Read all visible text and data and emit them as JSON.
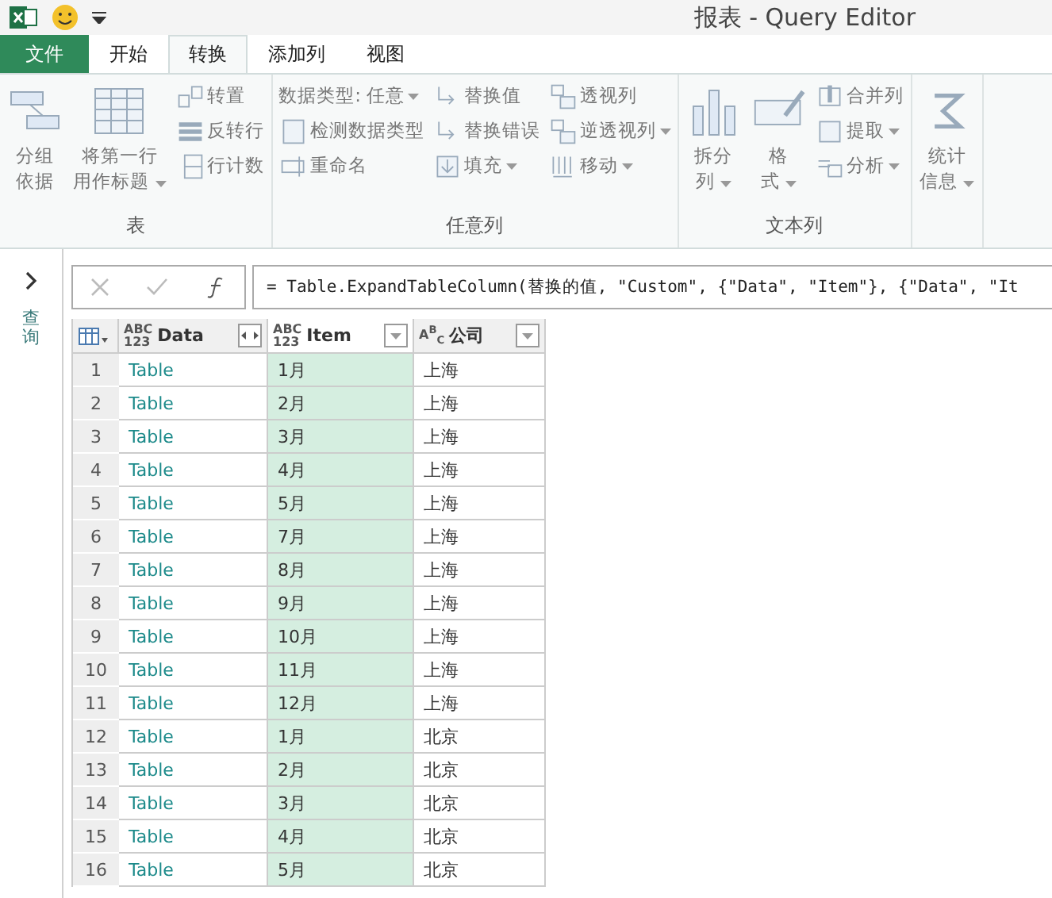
{
  "window": {
    "title": "报表 - Query Editor"
  },
  "tabs": [
    {
      "label": "文件",
      "kind": "file",
      "selected": false
    },
    {
      "label": "开始",
      "kind": "tab",
      "selected": false
    },
    {
      "label": "转换",
      "kind": "tab",
      "selected": true
    },
    {
      "label": "添加列",
      "kind": "tab",
      "selected": false
    },
    {
      "label": "视图",
      "kind": "tab",
      "selected": false
    }
  ],
  "ribbon": [
    {
      "label": "表",
      "columns": [
        [
          {
            "kind": "large",
            "lines": [
              "分组",
              "依据"
            ],
            "dropdown": false
          }
        ],
        [
          {
            "kind": "large",
            "lines": [
              "将第一行",
              "用作标题"
            ],
            "dropdown": true
          }
        ],
        [
          {
            "kind": "small",
            "label": "转置",
            "dropdown": false
          },
          {
            "kind": "small",
            "label": "反转行",
            "dropdown": false
          },
          {
            "kind": "small",
            "label": "行计数",
            "dropdown": false
          }
        ]
      ]
    },
    {
      "label": "任意列",
      "columns": [
        [
          {
            "kind": "small",
            "label": "数据类型: 任意",
            "dropdown": true
          },
          {
            "kind": "small",
            "label": "检测数据类型",
            "dropdown": false
          },
          {
            "kind": "small",
            "label": "重命名",
            "dropdown": false
          }
        ],
        [
          {
            "kind": "small",
            "label": "替换值",
            "dropdown": false
          },
          {
            "kind": "small",
            "label": "替换错误",
            "dropdown": false
          },
          {
            "kind": "small",
            "label": "填充",
            "dropdown": true
          }
        ],
        [
          {
            "kind": "small",
            "label": "透视列",
            "dropdown": false
          },
          {
            "kind": "small",
            "label": "逆透视列",
            "dropdown": true
          },
          {
            "kind": "small",
            "label": "移动",
            "dropdown": true
          }
        ]
      ]
    },
    {
      "label": "文本列",
      "columns": [
        [
          {
            "kind": "large",
            "lines": [
              "拆分",
              "列"
            ],
            "dropdown": true
          }
        ],
        [
          {
            "kind": "large",
            "lines": [
              "格",
              "式"
            ],
            "dropdown": true
          }
        ],
        [
          {
            "kind": "small",
            "label": "合并列",
            "dropdown": false
          },
          {
            "kind": "small",
            "label": "提取",
            "dropdown": true
          },
          {
            "kind": "small",
            "label": "分析",
            "dropdown": true
          }
        ]
      ]
    },
    {
      "columns": [
        [
          {
            "kind": "large",
            "lines": [
              "统计",
              "信息"
            ],
            "dropdown": true
          }
        ]
      ]
    }
  ],
  "sidebar": {
    "label": "查询"
  },
  "formula": {
    "text": "= Table.ExpandTableColumn(替换的值, \"Custom\", {\"Data\", \"Item\"}, {\"Data\", \"It"
  },
  "table": {
    "columns": [
      {
        "type_label": "ABC\n123",
        "name": "Data",
        "selected": false,
        "kind": "expandable"
      },
      {
        "type_label": "ABC\n123",
        "name": "Item",
        "selected": true,
        "kind": "filterable"
      },
      {
        "type_label": "A$^{B}$$_{C}$",
        "name": "公司",
        "selected": false,
        "kind": "filterable"
      }
    ],
    "rows": [
      {
        "number": "1",
        "cells": [
          "Table",
          "1月",
          "上海"
        ]
      },
      {
        "number": "2",
        "cells": [
          "Table",
          "2月",
          "上海"
        ]
      },
      {
        "number": "3",
        "cells": [
          "Table",
          "3月",
          "上海"
        ]
      },
      {
        "number": "4",
        "cells": [
          "Table",
          "4月",
          "上海"
        ]
      },
      {
        "number": "5",
        "cells": [
          "Table",
          "5月",
          "上海"
        ]
      },
      {
        "number": "6",
        "cells": [
          "Table",
          "7月",
          "上海"
        ]
      },
      {
        "number": "7",
        "cells": [
          "Table",
          "8月",
          "上海"
        ]
      },
      {
        "number": "8",
        "cells": [
          "Table",
          "9月",
          "上海"
        ]
      },
      {
        "number": "9",
        "cells": [
          "Table",
          "10月",
          "上海"
        ]
      },
      {
        "number": "10",
        "cells": [
          "Table",
          "11月",
          "上海"
        ]
      },
      {
        "number": "11",
        "cells": [
          "Table",
          "12月",
          "上海"
        ]
      },
      {
        "number": "12",
        "cells": [
          "Table",
          "1月",
          "北京"
        ]
      },
      {
        "number": "13",
        "cells": [
          "Table",
          "2月",
          "北京"
        ]
      },
      {
        "number": "14",
        "cells": [
          "Table",
          "3月",
          "北京"
        ]
      },
      {
        "number": "15",
        "cells": [
          "Table",
          "4月",
          "北京"
        ]
      },
      {
        "number": "16",
        "cells": [
          "Table",
          "5月",
          "北京"
        ]
      }
    ]
  }
}
